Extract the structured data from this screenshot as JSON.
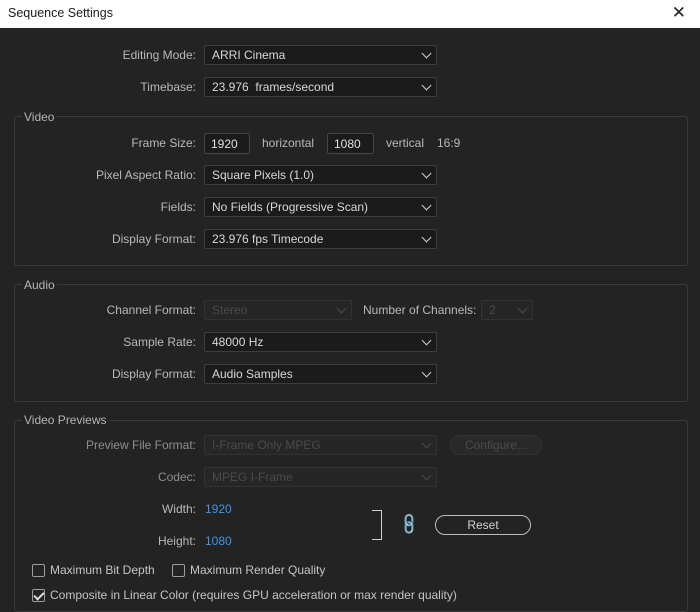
{
  "window": {
    "title": "Sequence Settings",
    "close_icon": "✕"
  },
  "general": {
    "editing_mode": {
      "label": "Editing Mode:",
      "value": "ARRI Cinema"
    },
    "timebase": {
      "label": "Timebase:",
      "value": "23.976  frames/second"
    }
  },
  "video": {
    "title": "Video",
    "frame_size": {
      "label": "Frame Size:",
      "width": "1920",
      "horizontal_label": "horizontal",
      "height": "1080",
      "vertical_label": "vertical",
      "aspect": "16:9"
    },
    "pixel_aspect_ratio": {
      "label": "Pixel Aspect Ratio:",
      "value": "Square Pixels (1.0)"
    },
    "fields": {
      "label": "Fields:",
      "value": "No Fields (Progressive Scan)"
    },
    "display_format": {
      "label": "Display Format:",
      "value": "23.976 fps Timecode"
    }
  },
  "audio": {
    "title": "Audio",
    "channel_format": {
      "label": "Channel Format:",
      "value": "Stereo"
    },
    "number_of_channels": {
      "label": "Number of Channels:",
      "value": "2"
    },
    "sample_rate": {
      "label": "Sample Rate:",
      "value": "48000 Hz"
    },
    "display_format": {
      "label": "Display Format:",
      "value": "Audio Samples"
    }
  },
  "video_previews": {
    "title": "Video Previews",
    "preview_file_format": {
      "label": "Preview File Format:",
      "value": "I-Frame Only MPEG"
    },
    "configure_label": "Configure...",
    "codec": {
      "label": "Codec:",
      "value": "MPEG I-Frame"
    },
    "width": {
      "label": "Width:",
      "value": "1920"
    },
    "height": {
      "label": "Height:",
      "value": "1080"
    },
    "reset_label": "Reset",
    "link_icon": "link-icon"
  },
  "options": {
    "max_bit_depth": {
      "label": "Maximum Bit Depth",
      "checked": false
    },
    "max_render_quality": {
      "label": "Maximum Render Quality",
      "checked": false
    },
    "composite_linear": {
      "label": "Composite in Linear Color (requires GPU acceleration or max render quality)",
      "checked": true
    }
  },
  "colors": {
    "background": "#232323",
    "accent_blue": "#3d96e8",
    "titlebar": "#ffffff"
  }
}
